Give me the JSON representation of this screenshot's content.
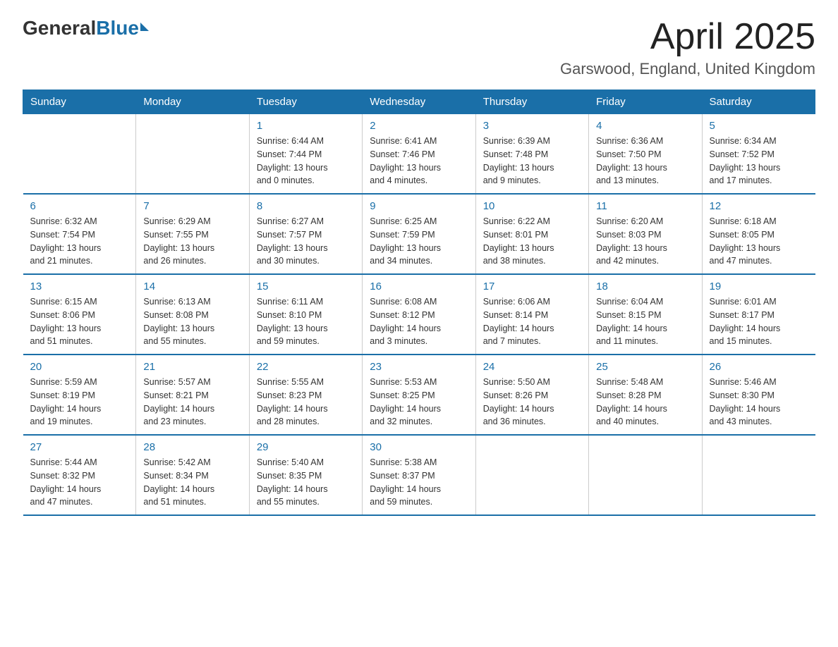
{
  "logo": {
    "general": "General",
    "blue": "Blue"
  },
  "header": {
    "title": "April 2025",
    "subtitle": "Garswood, England, United Kingdom"
  },
  "weekdays": [
    "Sunday",
    "Monday",
    "Tuesday",
    "Wednesday",
    "Thursday",
    "Friday",
    "Saturday"
  ],
  "weeks": [
    [
      {
        "day": "",
        "info": ""
      },
      {
        "day": "",
        "info": ""
      },
      {
        "day": "1",
        "info": "Sunrise: 6:44 AM\nSunset: 7:44 PM\nDaylight: 13 hours\nand 0 minutes."
      },
      {
        "day": "2",
        "info": "Sunrise: 6:41 AM\nSunset: 7:46 PM\nDaylight: 13 hours\nand 4 minutes."
      },
      {
        "day": "3",
        "info": "Sunrise: 6:39 AM\nSunset: 7:48 PM\nDaylight: 13 hours\nand 9 minutes."
      },
      {
        "day": "4",
        "info": "Sunrise: 6:36 AM\nSunset: 7:50 PM\nDaylight: 13 hours\nand 13 minutes."
      },
      {
        "day": "5",
        "info": "Sunrise: 6:34 AM\nSunset: 7:52 PM\nDaylight: 13 hours\nand 17 minutes."
      }
    ],
    [
      {
        "day": "6",
        "info": "Sunrise: 6:32 AM\nSunset: 7:54 PM\nDaylight: 13 hours\nand 21 minutes."
      },
      {
        "day": "7",
        "info": "Sunrise: 6:29 AM\nSunset: 7:55 PM\nDaylight: 13 hours\nand 26 minutes."
      },
      {
        "day": "8",
        "info": "Sunrise: 6:27 AM\nSunset: 7:57 PM\nDaylight: 13 hours\nand 30 minutes."
      },
      {
        "day": "9",
        "info": "Sunrise: 6:25 AM\nSunset: 7:59 PM\nDaylight: 13 hours\nand 34 minutes."
      },
      {
        "day": "10",
        "info": "Sunrise: 6:22 AM\nSunset: 8:01 PM\nDaylight: 13 hours\nand 38 minutes."
      },
      {
        "day": "11",
        "info": "Sunrise: 6:20 AM\nSunset: 8:03 PM\nDaylight: 13 hours\nand 42 minutes."
      },
      {
        "day": "12",
        "info": "Sunrise: 6:18 AM\nSunset: 8:05 PM\nDaylight: 13 hours\nand 47 minutes."
      }
    ],
    [
      {
        "day": "13",
        "info": "Sunrise: 6:15 AM\nSunset: 8:06 PM\nDaylight: 13 hours\nand 51 minutes."
      },
      {
        "day": "14",
        "info": "Sunrise: 6:13 AM\nSunset: 8:08 PM\nDaylight: 13 hours\nand 55 minutes."
      },
      {
        "day": "15",
        "info": "Sunrise: 6:11 AM\nSunset: 8:10 PM\nDaylight: 13 hours\nand 59 minutes."
      },
      {
        "day": "16",
        "info": "Sunrise: 6:08 AM\nSunset: 8:12 PM\nDaylight: 14 hours\nand 3 minutes."
      },
      {
        "day": "17",
        "info": "Sunrise: 6:06 AM\nSunset: 8:14 PM\nDaylight: 14 hours\nand 7 minutes."
      },
      {
        "day": "18",
        "info": "Sunrise: 6:04 AM\nSunset: 8:15 PM\nDaylight: 14 hours\nand 11 minutes."
      },
      {
        "day": "19",
        "info": "Sunrise: 6:01 AM\nSunset: 8:17 PM\nDaylight: 14 hours\nand 15 minutes."
      }
    ],
    [
      {
        "day": "20",
        "info": "Sunrise: 5:59 AM\nSunset: 8:19 PM\nDaylight: 14 hours\nand 19 minutes."
      },
      {
        "day": "21",
        "info": "Sunrise: 5:57 AM\nSunset: 8:21 PM\nDaylight: 14 hours\nand 23 minutes."
      },
      {
        "day": "22",
        "info": "Sunrise: 5:55 AM\nSunset: 8:23 PM\nDaylight: 14 hours\nand 28 minutes."
      },
      {
        "day": "23",
        "info": "Sunrise: 5:53 AM\nSunset: 8:25 PM\nDaylight: 14 hours\nand 32 minutes."
      },
      {
        "day": "24",
        "info": "Sunrise: 5:50 AM\nSunset: 8:26 PM\nDaylight: 14 hours\nand 36 minutes."
      },
      {
        "day": "25",
        "info": "Sunrise: 5:48 AM\nSunset: 8:28 PM\nDaylight: 14 hours\nand 40 minutes."
      },
      {
        "day": "26",
        "info": "Sunrise: 5:46 AM\nSunset: 8:30 PM\nDaylight: 14 hours\nand 43 minutes."
      }
    ],
    [
      {
        "day": "27",
        "info": "Sunrise: 5:44 AM\nSunset: 8:32 PM\nDaylight: 14 hours\nand 47 minutes."
      },
      {
        "day": "28",
        "info": "Sunrise: 5:42 AM\nSunset: 8:34 PM\nDaylight: 14 hours\nand 51 minutes."
      },
      {
        "day": "29",
        "info": "Sunrise: 5:40 AM\nSunset: 8:35 PM\nDaylight: 14 hours\nand 55 minutes."
      },
      {
        "day": "30",
        "info": "Sunrise: 5:38 AM\nSunset: 8:37 PM\nDaylight: 14 hours\nand 59 minutes."
      },
      {
        "day": "",
        "info": ""
      },
      {
        "day": "",
        "info": ""
      },
      {
        "day": "",
        "info": ""
      }
    ]
  ]
}
